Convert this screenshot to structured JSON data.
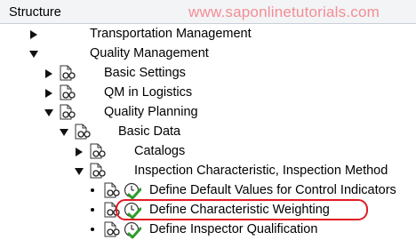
{
  "header": {
    "title": "Structure",
    "watermark": "www.saponlinetutorials.com"
  },
  "tree": {
    "transportation_management": "Transportation Management",
    "quality_management": "Quality Management",
    "basic_settings": "Basic Settings",
    "qm_in_logistics": "QM in Logistics",
    "quality_planning": "Quality Planning",
    "basic_data": "Basic Data",
    "catalogs": "Catalogs",
    "inspection_characteristic": "Inspection Characteristic, Inspection Method",
    "define_default_values": "Define Default Values for Control Indicators",
    "define_characteristic_weighting": "Define Characteristic Weighting",
    "define_inspector_qualification": "Define Inspector Qualification"
  },
  "icons": {
    "doc": "document-glasses-icon",
    "exec": "clock-check-icon"
  },
  "colors": {
    "watermark": "#f48c94",
    "highlight": "#e01b24",
    "check_green": "#2e9b2e"
  }
}
